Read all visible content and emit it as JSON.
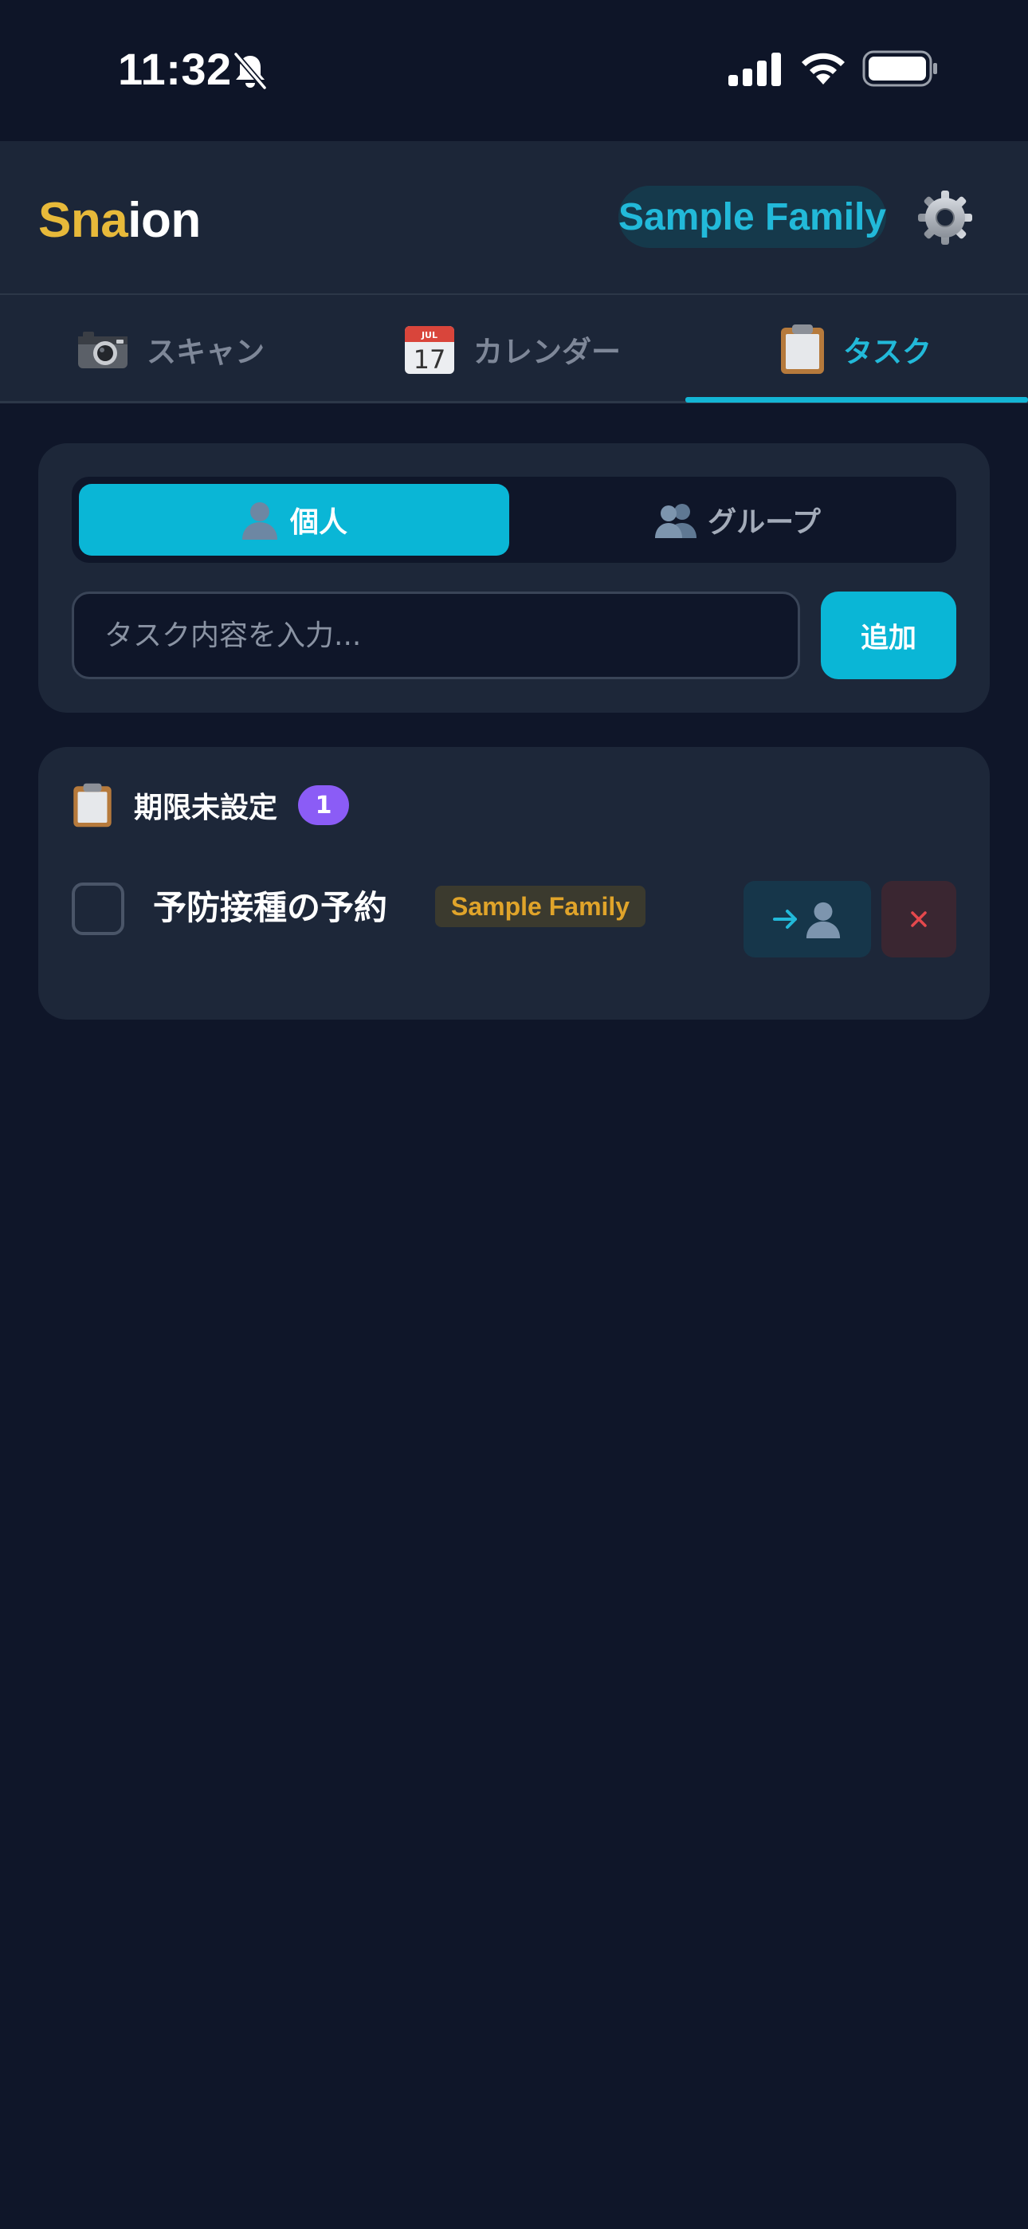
{
  "status_bar": {
    "time": "11:32"
  },
  "header": {
    "logo_part1": "Sna",
    "logo_part2": "ion",
    "family_name": "Sample Family",
    "settings_icon": "gear-icon"
  },
  "tabs": [
    {
      "label": "スキャン",
      "icon": "camera-icon",
      "active": false
    },
    {
      "label": "カレンダー",
      "icon": "calendar-icon",
      "active": false
    },
    {
      "label": "タスク",
      "icon": "clipboard-icon",
      "active": true
    }
  ],
  "task_form": {
    "segment_personal": "個人",
    "segment_group": "グループ",
    "input_placeholder": "タスク内容を入力...",
    "input_value": "",
    "add_label": "追加"
  },
  "task_list": {
    "section_title": "期限未設定",
    "count": "1",
    "items": [
      {
        "text": "予防接種の予約",
        "tag": "Sample Family",
        "assign_icon": "assign-to-person-icon",
        "delete_label": "×",
        "checked": false
      }
    ]
  },
  "colors": {
    "background": "#0f1629",
    "surface": "#1d2739",
    "accent": "#0ab6d6",
    "logo_gold": "#e7b93a",
    "badge": "#8b5cf6",
    "tag_text": "#e0a42a",
    "delete": "#e5484d"
  }
}
